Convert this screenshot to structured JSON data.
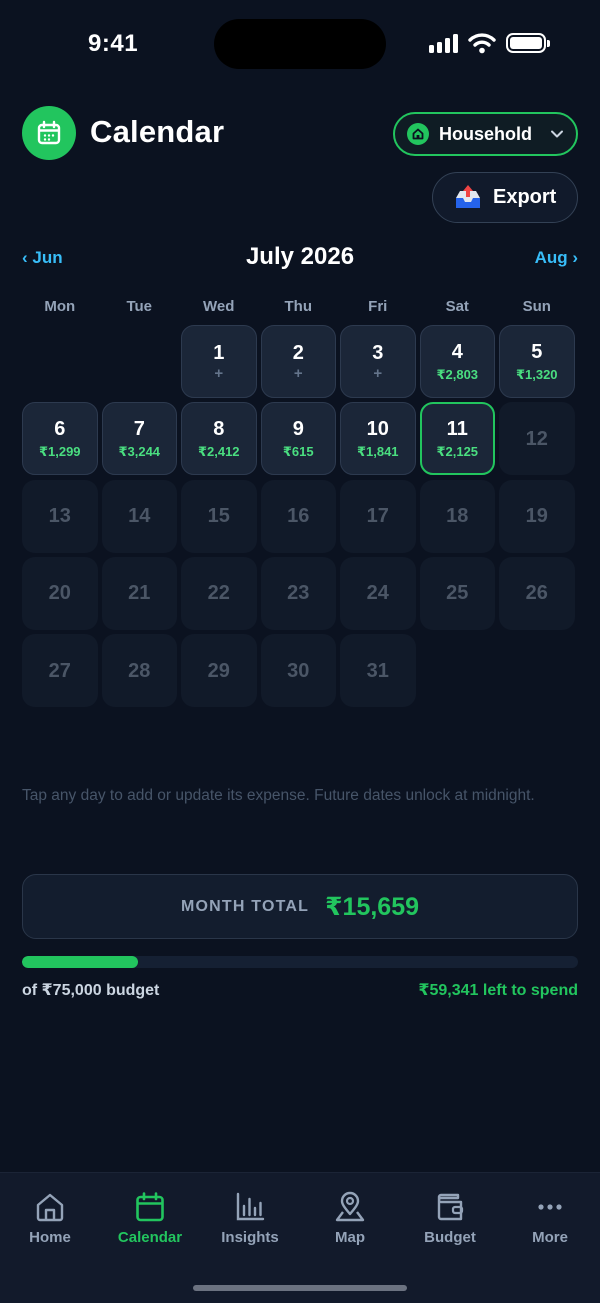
{
  "status": {
    "time": "9:41"
  },
  "header": {
    "title": "Calendar",
    "household_label": "Household",
    "export_label": "Export"
  },
  "month_nav": {
    "prev": "‹ Jun",
    "title": "July 2026",
    "next": "Aug ›"
  },
  "weekdays": [
    "Mon",
    "Tue",
    "Wed",
    "Thu",
    "Fri",
    "Sat",
    "Sun"
  ],
  "days": [
    {
      "day": "1",
      "amount": "",
      "state": "open"
    },
    {
      "day": "2",
      "amount": "",
      "state": "open"
    },
    {
      "day": "3",
      "amount": "",
      "state": "open"
    },
    {
      "day": "4",
      "amount": "₹2,803",
      "state": "spent"
    },
    {
      "day": "5",
      "amount": "₹1,320",
      "state": "spent"
    },
    {
      "day": "6",
      "amount": "₹1,299",
      "state": "spent"
    },
    {
      "day": "7",
      "amount": "₹3,244",
      "state": "spent"
    },
    {
      "day": "8",
      "amount": "₹2,412",
      "state": "spent"
    },
    {
      "day": "9",
      "amount": "₹615",
      "state": "spent"
    },
    {
      "day": "10",
      "amount": "₹1,841",
      "state": "spent"
    },
    {
      "day": "11",
      "amount": "₹2,125",
      "state": "selected"
    },
    {
      "day": "12",
      "amount": "",
      "state": "future"
    },
    {
      "day": "13",
      "amount": "",
      "state": "future"
    },
    {
      "day": "14",
      "amount": "",
      "state": "future"
    },
    {
      "day": "15",
      "amount": "",
      "state": "future"
    },
    {
      "day": "16",
      "amount": "",
      "state": "future"
    },
    {
      "day": "17",
      "amount": "",
      "state": "future"
    },
    {
      "day": "18",
      "amount": "",
      "state": "future"
    },
    {
      "day": "19",
      "amount": "",
      "state": "future"
    },
    {
      "day": "20",
      "amount": "",
      "state": "future"
    },
    {
      "day": "21",
      "amount": "",
      "state": "future"
    },
    {
      "day": "22",
      "amount": "",
      "state": "future"
    },
    {
      "day": "23",
      "amount": "",
      "state": "future"
    },
    {
      "day": "24",
      "amount": "",
      "state": "future"
    },
    {
      "day": "25",
      "amount": "",
      "state": "future"
    },
    {
      "day": "26",
      "amount": "",
      "state": "future"
    },
    {
      "day": "27",
      "amount": "",
      "state": "future"
    },
    {
      "day": "28",
      "amount": "",
      "state": "future"
    },
    {
      "day": "29",
      "amount": "",
      "state": "future"
    },
    {
      "day": "30",
      "amount": "",
      "state": "future"
    },
    {
      "day": "31",
      "amount": "",
      "state": "future"
    }
  ],
  "calendar": {
    "add_symbol": "+"
  },
  "hint": "Tap any day to add or update its expense. Future dates unlock at midnight.",
  "summary": {
    "total_label": "MONTH TOTAL",
    "total_value": "₹15,659",
    "budget_text": "of ₹75,000 budget",
    "left_text": "₹59,341 left to spend",
    "progress_fraction": 0.209
  },
  "tabs": [
    {
      "label": "Home",
      "icon": "home-icon"
    },
    {
      "label": "Calendar",
      "icon": "calendar-icon"
    },
    {
      "label": "Insights",
      "icon": "bar-chart-icon"
    },
    {
      "label": "Map",
      "icon": "map-pin-icon"
    },
    {
      "label": "Budget",
      "icon": "wallet-icon"
    },
    {
      "label": "More",
      "icon": "more-icon"
    }
  ],
  "colors": {
    "accent": "#22c55e",
    "link": "#38bdf8",
    "background": "#0b1220"
  }
}
